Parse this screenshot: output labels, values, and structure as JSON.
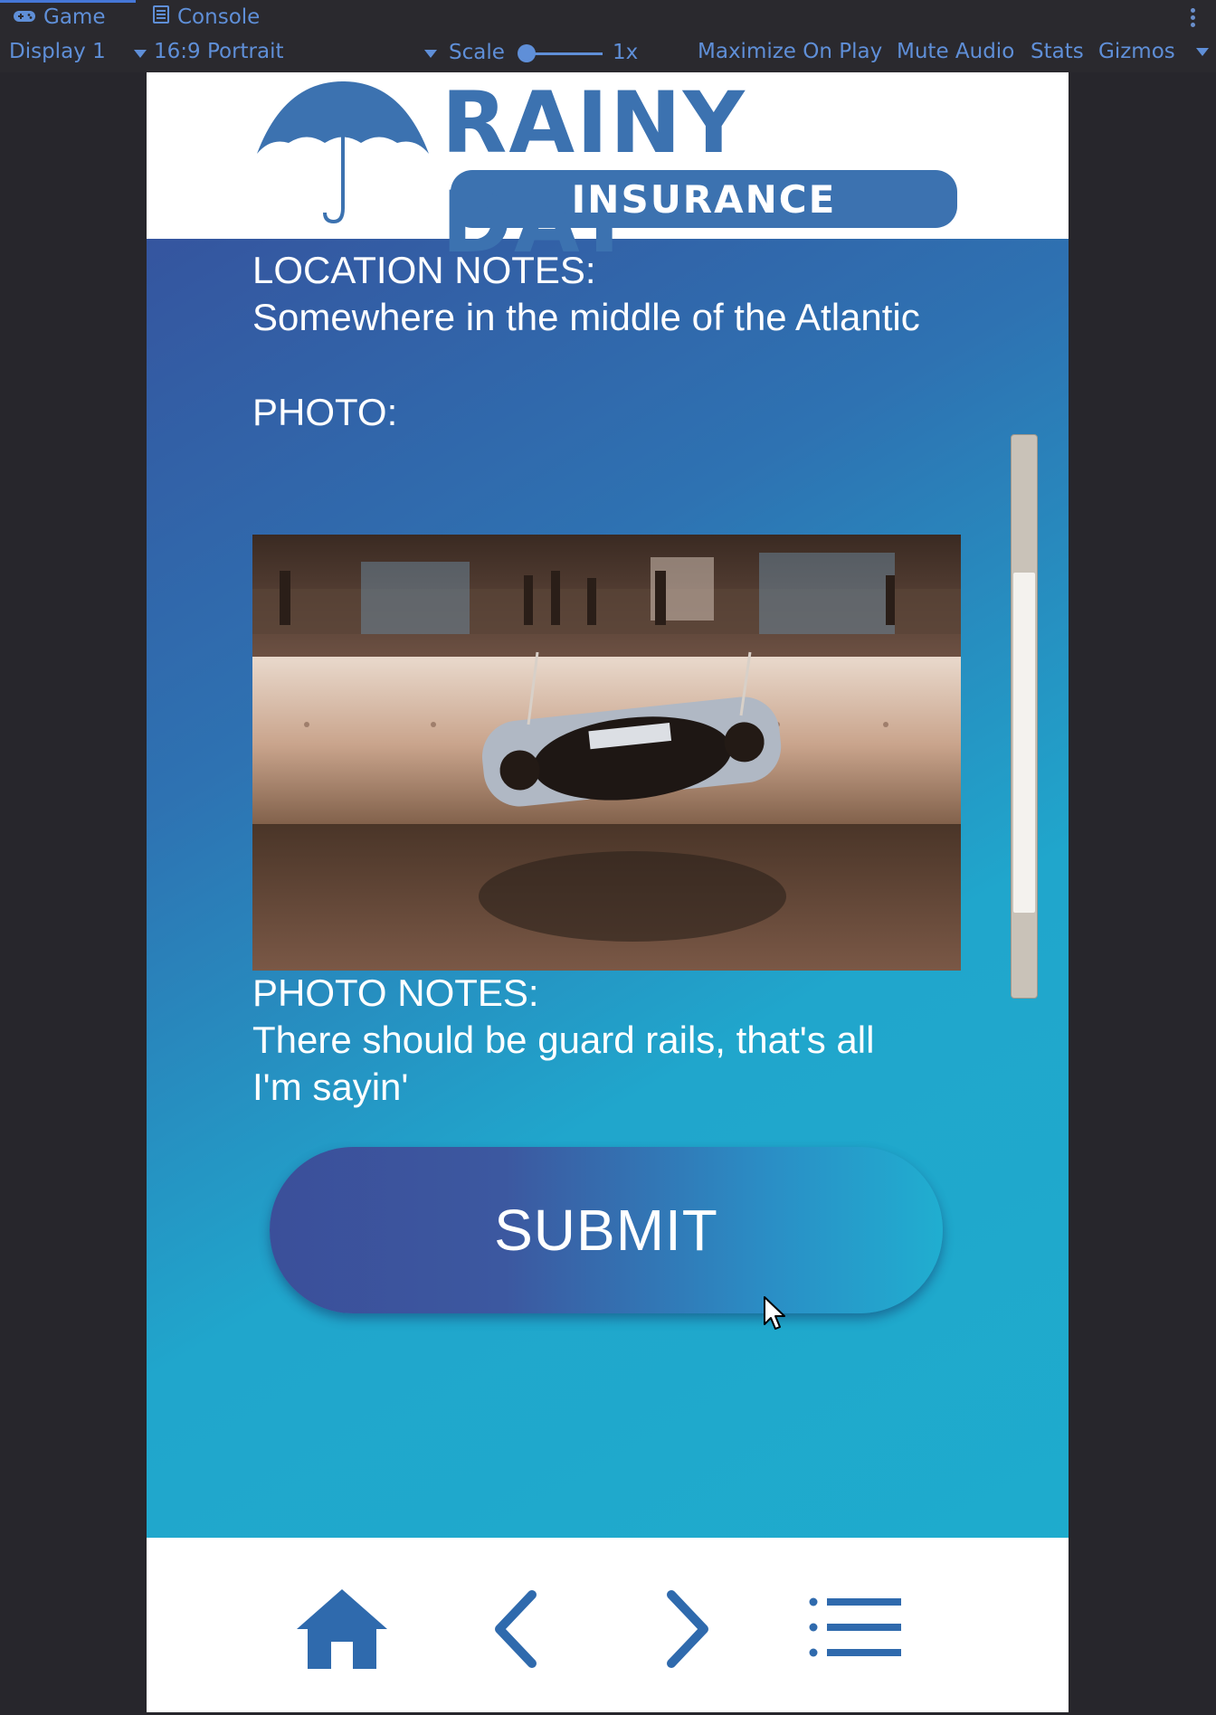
{
  "editor": {
    "tabs": [
      {
        "label": "Game",
        "icon": "gamepad-icon"
      },
      {
        "label": "Console",
        "icon": "console-icon"
      }
    ],
    "toolbar": {
      "display": "Display 1",
      "aspect": "16:9 Portrait",
      "scale_label": "Scale",
      "scale_value": "1x",
      "maximize": "Maximize On Play",
      "mute": "Mute Audio",
      "stats": "Stats",
      "gizmos": "Gizmos"
    }
  },
  "app": {
    "brand": {
      "title": "RAINY DAY",
      "subtitle": "INSURANCE",
      "color": "#3c72b0"
    },
    "form": {
      "location_notes_label": "LOCATION NOTES:",
      "location_notes_value": "Somewhere in the middle of the Atlantic",
      "photo_label": "PHOTO:",
      "photo_notes_label": "PHOTO NOTES:",
      "photo_notes_line1": "There should be guard rails, that's all",
      "photo_notes_line2": "I'm sayin'"
    },
    "submit_label": "SUBMIT",
    "nav": [
      "home-icon",
      "back-icon",
      "forward-icon",
      "menu-icon"
    ],
    "accent_color": "#1eaccd"
  }
}
